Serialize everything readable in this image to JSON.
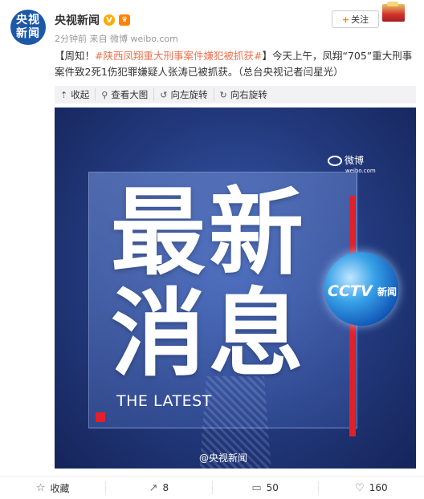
{
  "author": {
    "avatar_text": "央视新闻",
    "name": "央视新闻",
    "verified_icon": "V",
    "meta": "2分钟前 来自 微博 weibo.com"
  },
  "follow_button": {
    "icon": "+",
    "label": "关注"
  },
  "post": {
    "lead": "【周知！",
    "topic": "#陕西凤翔重大刑事案件嫌犯被抓获#",
    "body": "】今天上午，凤翔“705”重大刑事案件致2死1伤犯罪嫌疑人张涛已被抓获。（总台央视记者闫星光）"
  },
  "image_toolbar": [
    {
      "icon": "collapse-icon",
      "glyph": "⇡",
      "label": "收起"
    },
    {
      "icon": "magnify-icon",
      "glyph": "⚲",
      "label": "查看大图"
    },
    {
      "icon": "rotate-left-icon",
      "glyph": "↺",
      "label": "向左旋转"
    },
    {
      "icon": "rotate-right-icon",
      "glyph": "↻",
      "label": "向右旋转"
    }
  ],
  "image": {
    "weibo_watermark": "微博",
    "weibo_url": "weibo.com",
    "headline_line1": "最新",
    "headline_line2": "消息",
    "subtitle": "THE LATEST",
    "logo_text": "CCTV",
    "logo_sub": "新闻",
    "bottom_watermark": "@央视新闻"
  },
  "actions": [
    {
      "icon": "star-icon",
      "glyph": "☆",
      "label": "收藏"
    },
    {
      "icon": "share-icon",
      "glyph": "↗",
      "label": "8"
    },
    {
      "icon": "comment-icon",
      "glyph": "▭",
      "label": "50"
    },
    {
      "icon": "like-icon",
      "glyph": "♡",
      "label": "160"
    }
  ],
  "colors": {
    "accent_orange": "#ff8200",
    "topic_link": "#eb7350",
    "image_red": "#e3202a",
    "image_blue": "#22397c"
  }
}
